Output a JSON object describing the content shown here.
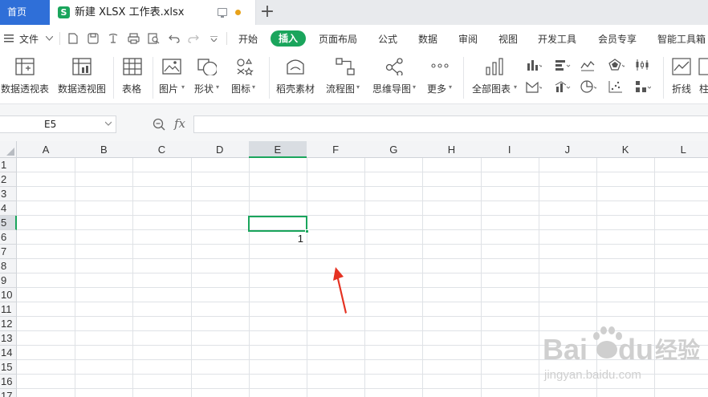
{
  "tabs": {
    "home": "首页",
    "doc_icon": "S",
    "doc_title": "新建 XLSX 工作表.xlsx",
    "new_tab": "+"
  },
  "menu": {
    "file": "文件",
    "items": [
      "开始",
      "插入",
      "页面布局",
      "公式",
      "数据",
      "审阅",
      "视图",
      "开发工具",
      "会员专享",
      "智能工具箱"
    ],
    "active": "插入"
  },
  "ribbon": {
    "buttons": [
      "数据透视表",
      "数据透视图",
      "表格",
      "图片",
      "形状",
      "图标",
      "稻壳素材",
      "流程图",
      "思维导图",
      "更多",
      "全部图表",
      "折线",
      "柱"
    ]
  },
  "formula_bar": {
    "name_box": "E5",
    "fx": "fx",
    "value": ""
  },
  "sheet": {
    "columns": [
      "A",
      "B",
      "C",
      "D",
      "E",
      "F",
      "G",
      "H",
      "I",
      "J",
      "K",
      "L"
    ],
    "rows": [
      "1",
      "2",
      "3",
      "4",
      "5",
      "6",
      "7",
      "8",
      "9",
      "10",
      "11",
      "12",
      "13",
      "14",
      "15",
      "16",
      "17"
    ],
    "active_cell": "E5",
    "cells": {
      "E6": "1"
    }
  },
  "watermark": {
    "brand": "Bai du 经验",
    "url": "jingyan.baidu.com"
  },
  "colors": {
    "accent": "#1aa55c",
    "home_tab": "#2f6fd8",
    "arrow": "#e53222"
  }
}
